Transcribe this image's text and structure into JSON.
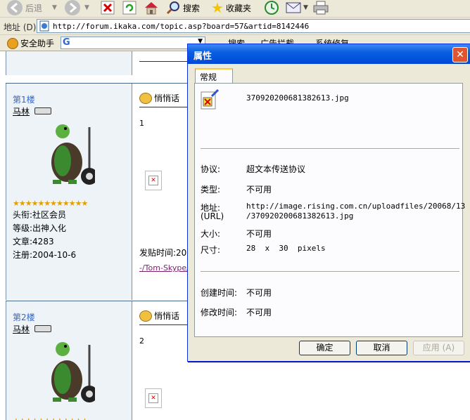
{
  "toolbar": {
    "back_label": "后退",
    "search_label": "搜索",
    "favorites_label": "收藏夹"
  },
  "address_bar": {
    "label": "地址 (D)",
    "url": "http://forum.ikaka.com/topic.asp?board=57&artid=8142446"
  },
  "links_bar": {
    "security_label": "安全助手",
    "search_label": "搜索",
    "ads_label": "广告拦截",
    "repair_label": "系统修复"
  },
  "posts": [
    {
      "floor": "第1楼",
      "username": "马林",
      "stars": "★★★★★★★★★★★★",
      "title_line": "头衔:社区会员",
      "level_line": "等级:出神入化",
      "articles_line": "文章:4283",
      "registered_line": "注册:2004-10-6",
      "qq_label": "悄悄话",
      "number": "1",
      "post_time_label": "发贴时间:200",
      "signature": "-/Tom-Skype/"
    },
    {
      "floor": "第2楼",
      "username": "马林",
      "stars": "★★★★★★★★★★★★",
      "qq_label": "悄悄话",
      "number": "2"
    }
  ],
  "dialog": {
    "title": "属性",
    "close_symbol": "✕",
    "tab": "常规",
    "filename": "370920200681382613.jpg",
    "protocol_label": "协议:",
    "protocol_value": "超文本传送协议",
    "type_label": "类型:",
    "type_value": "不可用",
    "address_label": "地址:",
    "address_label_2": "(URL)",
    "address_value_1": "http://image.rising.com.cn/uploadfiles/20068/13",
    "address_value_2": "/370920200681382613.jpg",
    "size_label": "大小:",
    "size_value": "不可用",
    "dimensions_label": "尺寸:",
    "dimensions_value": "28  x  30  pixels",
    "created_label": "创建时间:",
    "created_value": "不可用",
    "modified_label": "修改时间:",
    "modified_value": "不可用",
    "ok_button": "确定",
    "cancel_button": "取消",
    "apply_button": "应用 (A)"
  },
  "colors": {
    "title_bar": "#0a5fe0",
    "star": "#e0a000",
    "floor_link": "#3366cc",
    "signature": "#7a1f6b"
  }
}
